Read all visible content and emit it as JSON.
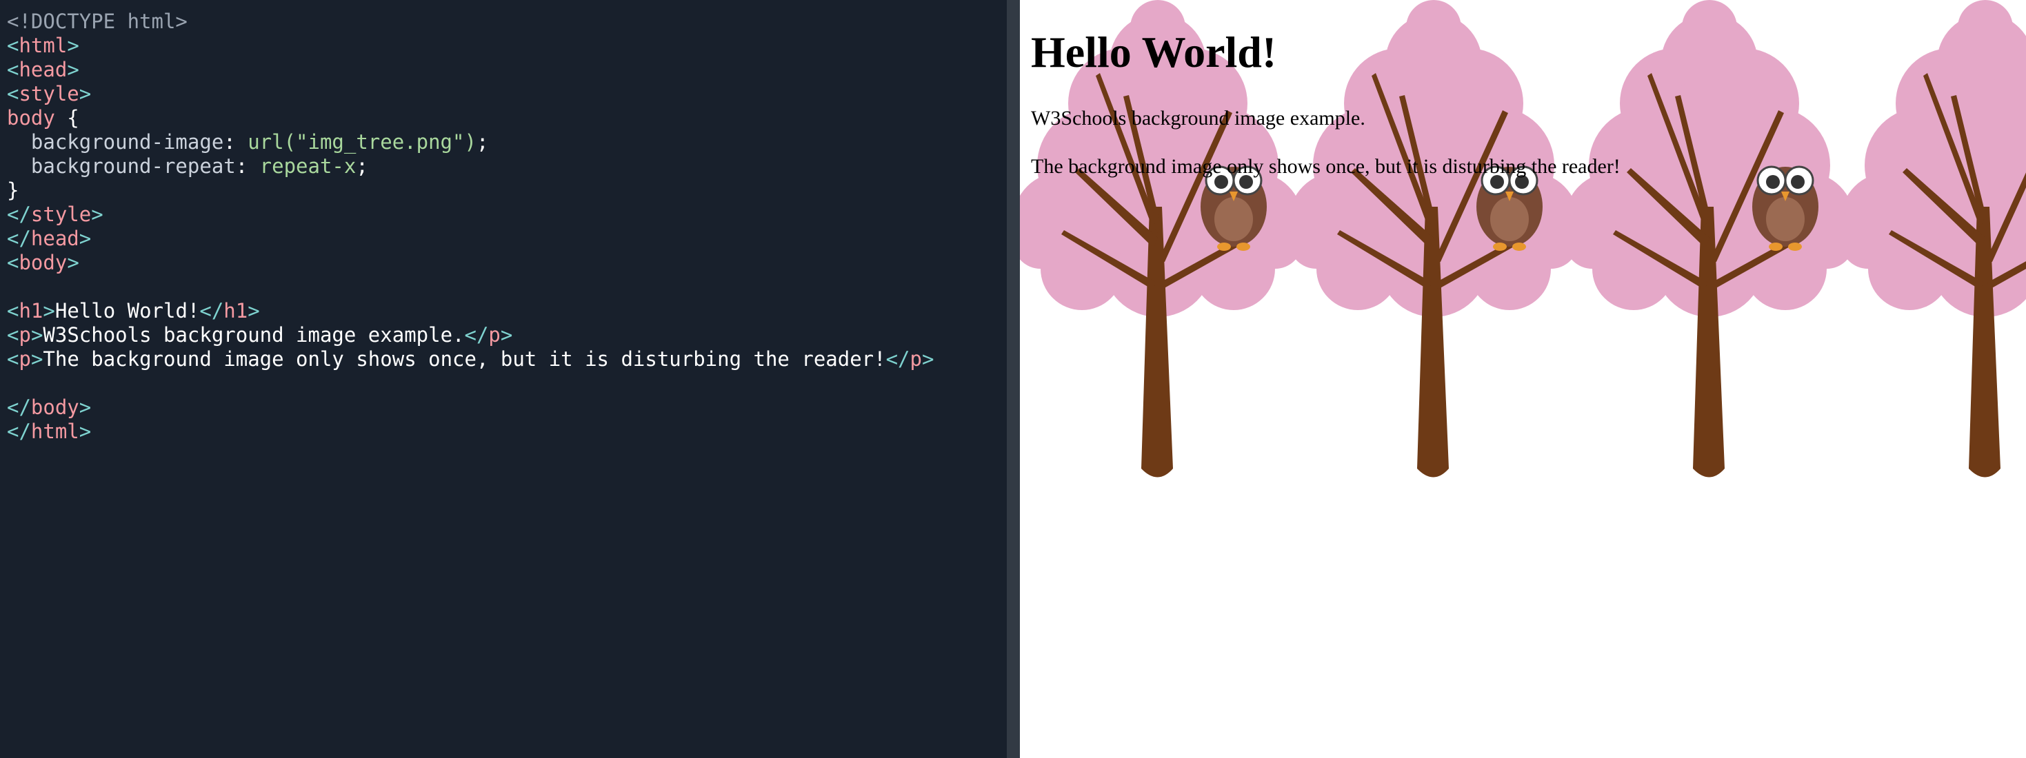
{
  "editor": {
    "lines": [
      [
        [
          "t-doctype",
          "<!DOCTYPE html>"
        ]
      ],
      [
        [
          "t-punct",
          "<"
        ],
        [
          "t-tag",
          "html"
        ],
        [
          "t-punct",
          ">"
        ]
      ],
      [
        [
          "t-punct",
          "<"
        ],
        [
          "t-tag",
          "head"
        ],
        [
          "t-punct",
          ">"
        ]
      ],
      [
        [
          "t-punct",
          "<"
        ],
        [
          "t-tag",
          "style"
        ],
        [
          "t-punct",
          ">"
        ]
      ],
      [
        [
          "t-selector",
          "body"
        ],
        [
          "t-text",
          " {"
        ]
      ],
      [
        [
          "t-text",
          "  "
        ],
        [
          "t-prop",
          "background-image"
        ],
        [
          "t-text",
          ": "
        ],
        [
          "t-fn",
          "url("
        ],
        [
          "t-str",
          "\"img_tree.png\""
        ],
        [
          "t-fn",
          ")"
        ],
        [
          "t-text",
          ";"
        ]
      ],
      [
        [
          "t-text",
          "  "
        ],
        [
          "t-prop",
          "background-repeat"
        ],
        [
          "t-text",
          ": "
        ],
        [
          "t-val",
          "repeat-x"
        ],
        [
          "t-text",
          ";"
        ]
      ],
      [
        [
          "t-text",
          "}"
        ]
      ],
      [
        [
          "t-punct",
          "</"
        ],
        [
          "t-tag",
          "style"
        ],
        [
          "t-punct",
          ">"
        ]
      ],
      [
        [
          "t-punct",
          "</"
        ],
        [
          "t-tag",
          "head"
        ],
        [
          "t-punct",
          ">"
        ]
      ],
      [
        [
          "t-punct",
          "<"
        ],
        [
          "t-tag",
          "body"
        ],
        [
          "t-punct",
          ">"
        ]
      ],
      [],
      [
        [
          "t-punct",
          "<"
        ],
        [
          "t-tag",
          "h1"
        ],
        [
          "t-punct",
          ">"
        ],
        [
          "t-text",
          "Hello World!"
        ],
        [
          "t-punct",
          "</"
        ],
        [
          "t-tag",
          "h1"
        ],
        [
          "t-punct",
          ">"
        ]
      ],
      [
        [
          "t-punct",
          "<"
        ],
        [
          "t-tag",
          "p"
        ],
        [
          "t-punct",
          ">"
        ],
        [
          "t-text",
          "W3Schools background image example."
        ],
        [
          "t-punct",
          "</"
        ],
        [
          "t-tag",
          "p"
        ],
        [
          "t-punct",
          ">"
        ]
      ],
      [
        [
          "t-punct",
          "<"
        ],
        [
          "t-tag",
          "p"
        ],
        [
          "t-punct",
          ">"
        ],
        [
          "t-text",
          "The background image only shows once, but it is disturbing the reader!"
        ],
        [
          "t-punct",
          "</"
        ],
        [
          "t-tag",
          "p"
        ],
        [
          "t-punct",
          ">"
        ]
      ],
      [],
      [
        [
          "t-punct",
          "</"
        ],
        [
          "t-tag",
          "body"
        ],
        [
          "t-punct",
          ">"
        ]
      ],
      [
        [
          "t-punct",
          "</"
        ],
        [
          "t-tag",
          "html"
        ],
        [
          "t-punct",
          ">"
        ]
      ]
    ]
  },
  "result": {
    "heading": "Hello World!",
    "paragraph1": "W3Schools background image example.",
    "paragraph2": "The background image only shows once, but it is disturbing the reader!",
    "background_image": "tree-with-owl-icon",
    "background_repeat": "repeat-x",
    "colors": {
      "blossom": "#e5a8c8",
      "trunk": "#6e3a16",
      "owl_body": "#7a4a35"
    }
  }
}
